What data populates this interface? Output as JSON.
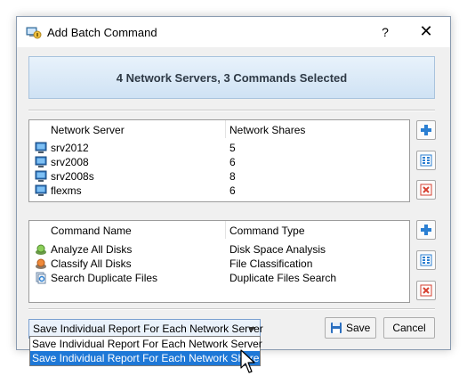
{
  "window": {
    "title": "Add Batch Command",
    "help_glyph": "?",
    "close_glyph": "✕"
  },
  "banner": {
    "text": "4 Network Servers, 3 Commands Selected"
  },
  "servers": {
    "headers": [
      "Network Server",
      "Network Shares"
    ],
    "rows": [
      {
        "name": "srv2012",
        "shares": "5",
        "icon": "server-icon"
      },
      {
        "name": "srv2008",
        "shares": "6",
        "icon": "server-icon"
      },
      {
        "name": "srv2008s",
        "shares": "8",
        "icon": "server-icon"
      },
      {
        "name": "flexms",
        "shares": "6",
        "icon": "server-icon"
      }
    ]
  },
  "commands": {
    "headers": [
      "Command Name",
      "Command Type"
    ],
    "rows": [
      {
        "name": "Analyze All Disks",
        "type": "Disk Space Analysis",
        "icon": "disk-analysis-icon"
      },
      {
        "name": "Classify All Disks",
        "type": "File Classification",
        "icon": "file-classification-icon"
      },
      {
        "name": "Search Duplicate Files",
        "type": "Duplicate Files Search",
        "icon": "duplicate-search-icon"
      }
    ]
  },
  "side_buttons": [
    "add-icon",
    "edit-icon",
    "remove-icon"
  ],
  "report_select": {
    "selected": "Save Individual Report For Each Network Server",
    "options": [
      "Save Individual Report For Each Network Server",
      "Save Individual Report For Each Network Share"
    ],
    "highlighted_index": 1
  },
  "buttons": {
    "save": "Save",
    "cancel": "Cancel"
  },
  "colors": {
    "accent": "#1e78d7",
    "banner_text": "#2f3a46",
    "remove": "#d64030",
    "add": "#2b7fd2"
  }
}
